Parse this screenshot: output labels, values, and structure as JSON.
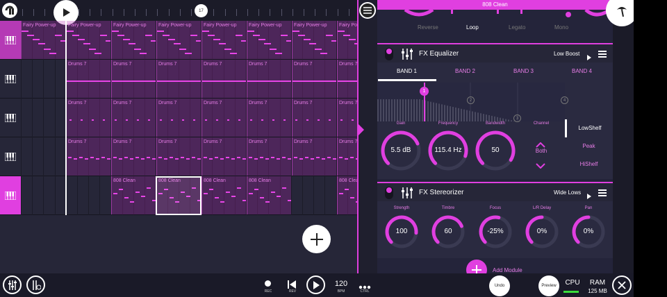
{
  "timeline": {
    "bar_marker": "17",
    "tracks": [
      {
        "clips": [
          "Fairy Power-up",
          "Fairy Power-up",
          "Fairy Power-up",
          "Fairy Power-up",
          "Fairy Power-up",
          "Fairy Power-up",
          "Fairy Power-up",
          "Fairy Power-up"
        ]
      },
      {
        "clips": [
          "Drums 7",
          "Drums 7",
          "Drums 7",
          "Drums 7",
          "Drums 7",
          "Drums 7",
          "Drums 7"
        ]
      },
      {
        "clips": [
          "Drums 7",
          "Drums 7",
          "Drums 7",
          "Drums 7",
          "Drums 7",
          "Drums 7",
          "Drums 7"
        ]
      },
      {
        "clips": [
          "Drums 7",
          "Drums 7",
          "Drums 7",
          "Drums 7",
          "Drums 7",
          "Drums 7",
          "Drums 7"
        ]
      },
      {
        "clips": [
          "808 Clean",
          "808 Clean",
          "808 Clean",
          "808 Clean",
          "808 Clean"
        ]
      }
    ]
  },
  "instrument": {
    "title": "808 Clean",
    "modes": [
      "Reverse",
      "Loop",
      "Legato",
      "Mono"
    ],
    "active_mode": "Loop"
  },
  "fx_eq": {
    "title": "FX Equalizer",
    "preset": "Low Boost",
    "bands": [
      "BAND 1",
      "BAND 2",
      "BAND 3",
      "BAND 4"
    ],
    "active_band": "BAND 1",
    "points": [
      "1",
      "2",
      "3",
      "4"
    ],
    "knobs": [
      {
        "label": "Gain",
        "value": "5.5 dB",
        "level": 0.75
      },
      {
        "label": "Frequency",
        "value": "115.4 Hz",
        "level": 0.9
      },
      {
        "label": "Bandwidth",
        "value": "50",
        "level": 0.95
      }
    ],
    "channel_label": "Channel",
    "channel_value": "Both",
    "filter_types": [
      "LowShelf",
      "Peak",
      "HiShelf"
    ],
    "active_filter": "LowShelf"
  },
  "fx_stereo": {
    "title": "FX Stereorizer",
    "preset": "Wide Lows",
    "knobs": [
      {
        "label": "Strength",
        "value": "100",
        "level": 0.85
      },
      {
        "label": "Timbre",
        "value": "60",
        "level": 0.75
      },
      {
        "label": "Focus",
        "value": "-25%",
        "level": 0.55
      },
      {
        "label": "L/R Delay",
        "value": "0%",
        "level": 0.5
      },
      {
        "label": "Pan",
        "value": "0%",
        "level": 0.5
      }
    ]
  },
  "add_module": "Add Module",
  "transport": {
    "rec": "REC",
    "rev": "REV",
    "bpm_value": "120",
    "bpm": "BPM",
    "ctrl": "CTRL",
    "undo": "Undo",
    "preview": "Preview",
    "cpu": "CPU",
    "ram": "RAM",
    "ram_value": "125 MB"
  },
  "colors": {
    "accent": "#e03fe0",
    "bg": "#24243a"
  }
}
